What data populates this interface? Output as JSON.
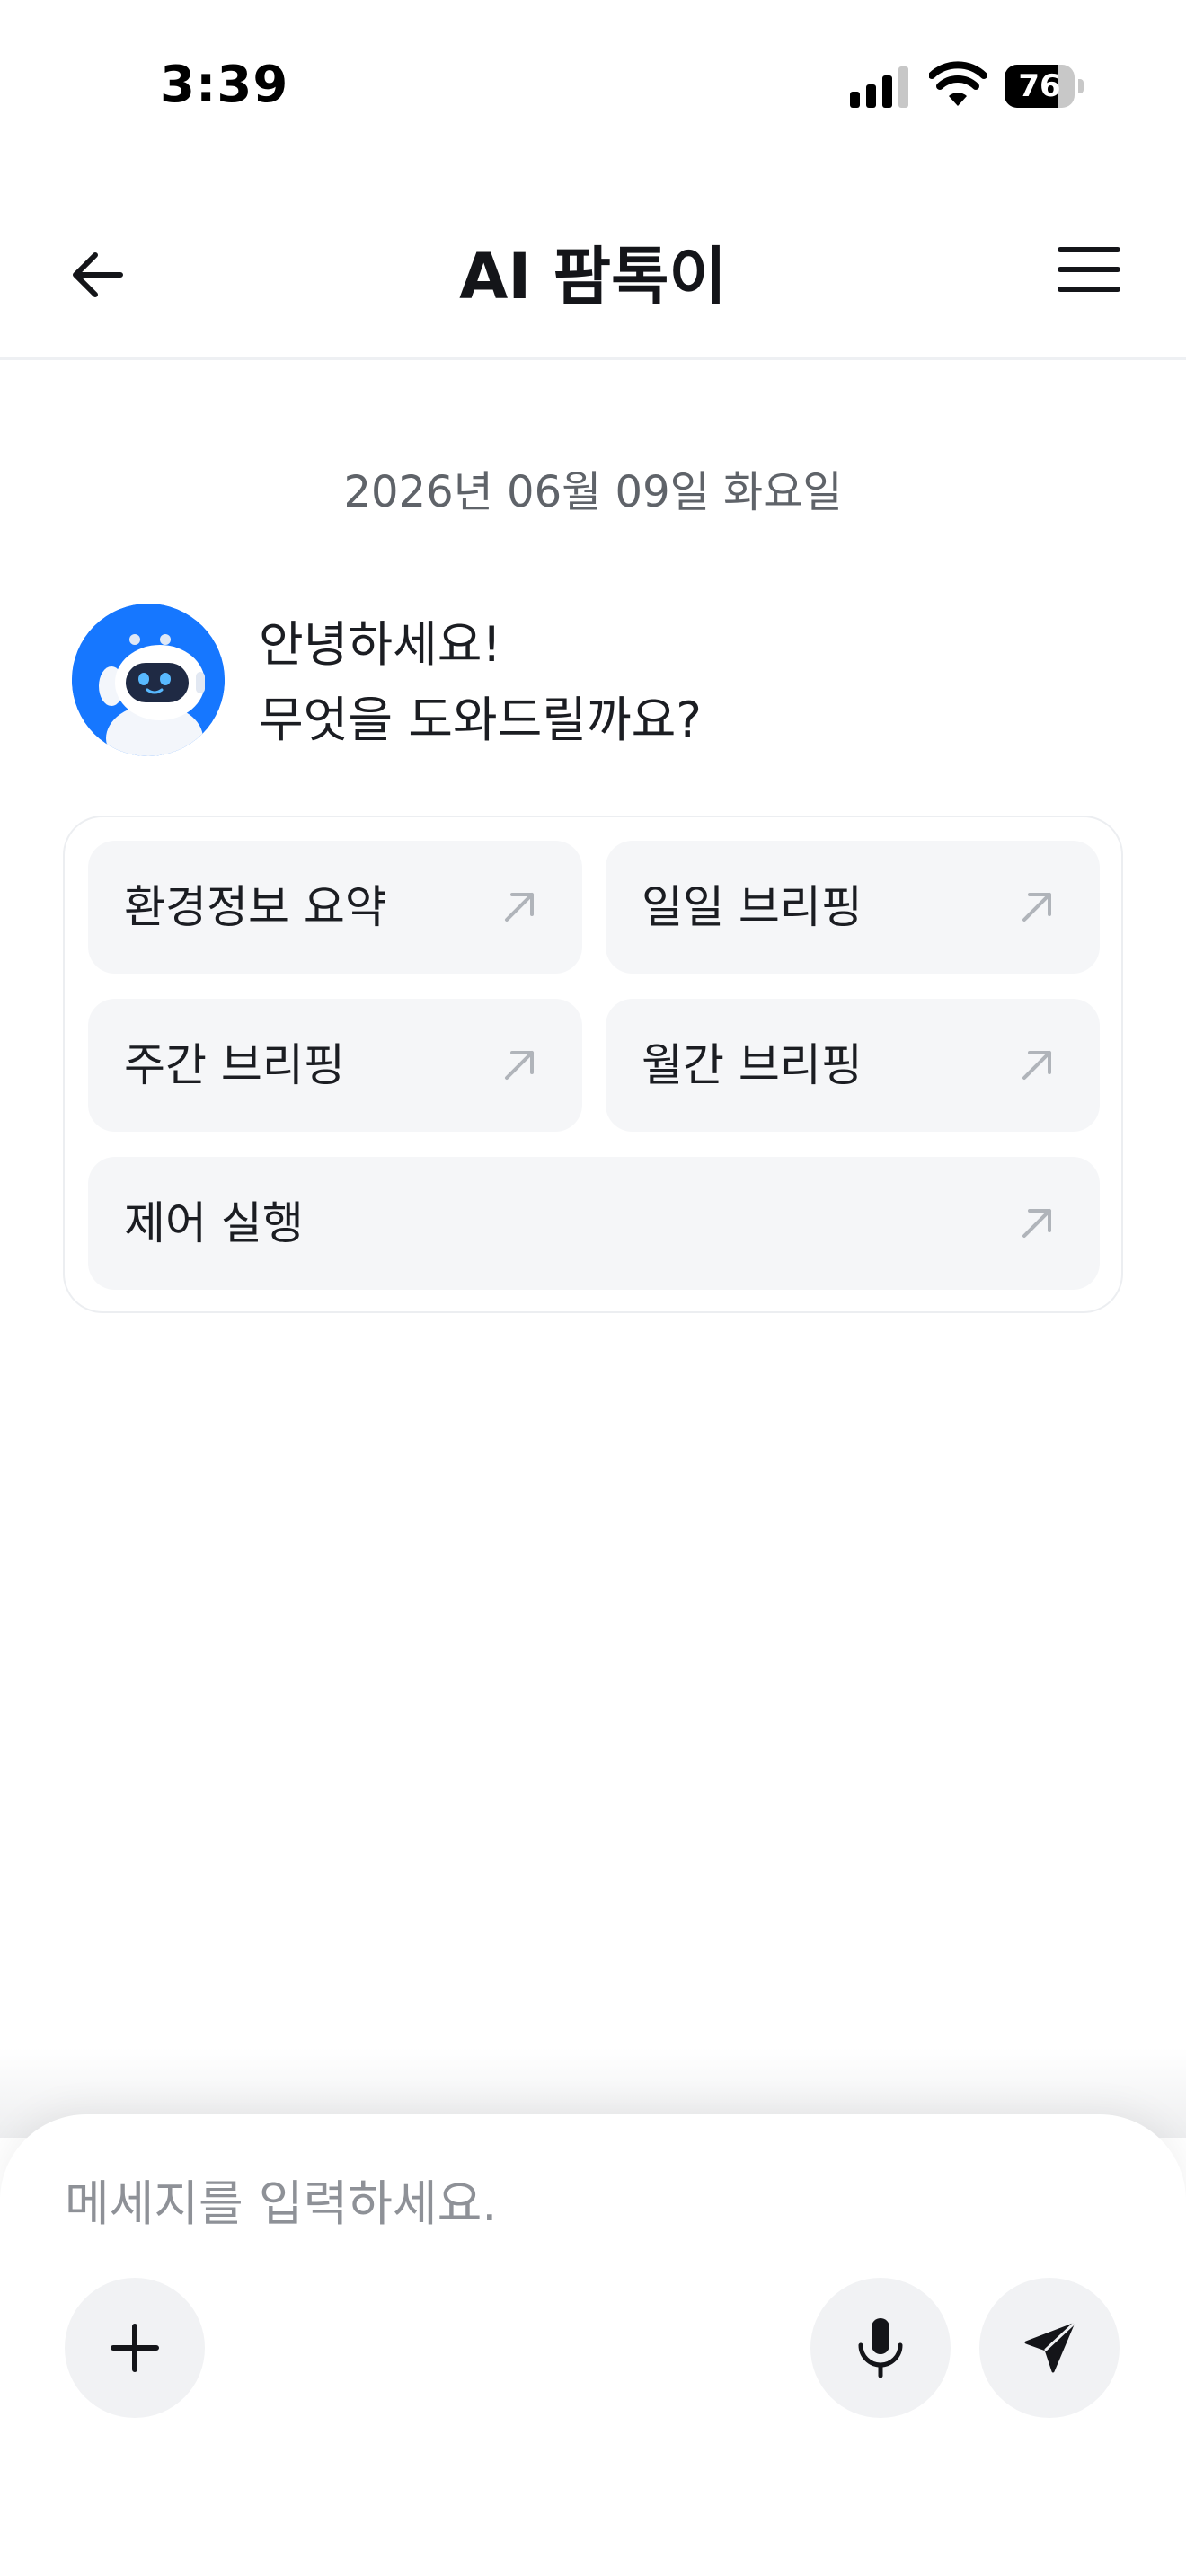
{
  "status_bar": {
    "time": "3:39",
    "battery_level": "76",
    "icons": [
      "cellular-signal-icon",
      "wifi-icon",
      "battery-icon"
    ]
  },
  "header": {
    "title": "AI 팜톡이",
    "back_icon": "arrow-left-icon",
    "menu_icon": "hamburger-menu-icon"
  },
  "chat": {
    "date": "2026년 06월 09일 화요일",
    "bot_avatar_icon": "robot-avatar-icon",
    "greeting_line1": "안녕하세요!",
    "greeting_line2": "무엇을 도와드릴까요?"
  },
  "quick_actions": [
    {
      "label": "환경정보 요약",
      "icon": "arrow-up-right-icon"
    },
    {
      "label": "일일 브리핑",
      "icon": "arrow-up-right-icon"
    },
    {
      "label": "주간 브리핑",
      "icon": "arrow-up-right-icon"
    },
    {
      "label": "월간 브리핑",
      "icon": "arrow-up-right-icon"
    },
    {
      "label": "제어 실행",
      "icon": "arrow-up-right-icon"
    }
  ],
  "composer": {
    "placeholder": "메세지를 입력하세요.",
    "value": "",
    "add_icon": "plus-icon",
    "mic_icon": "microphone-icon",
    "send_icon": "send-icon"
  },
  "colors": {
    "accent": "#1677ff",
    "text": "#1b1d22",
    "muted": "#5f6369",
    "button_bg": "#f5f6f8"
  }
}
